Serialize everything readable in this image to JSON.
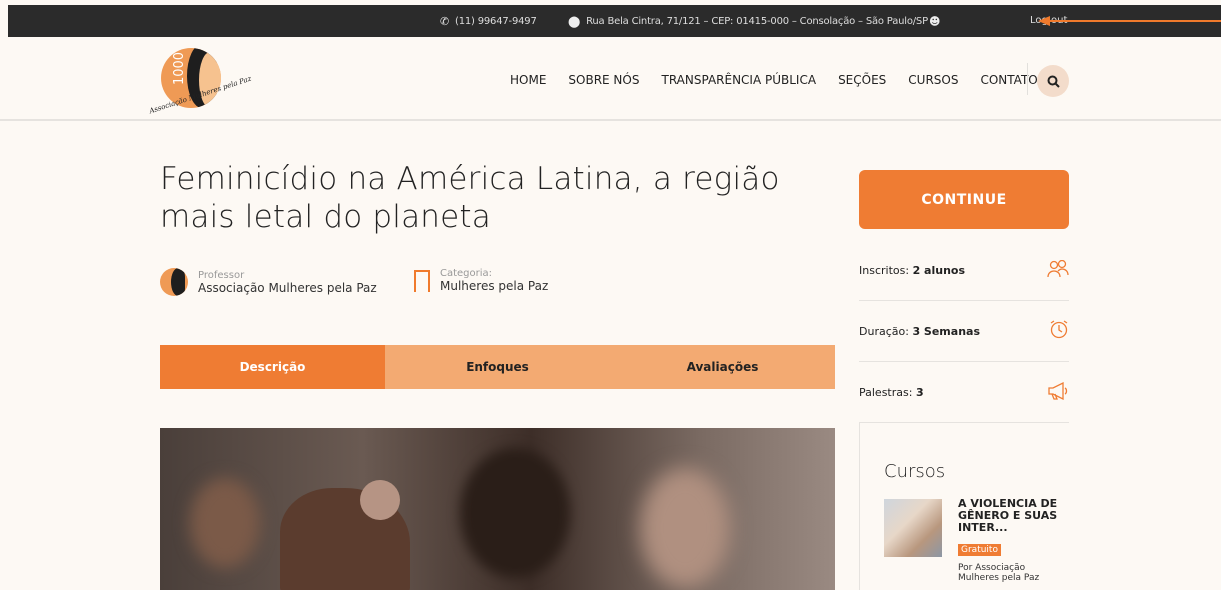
{
  "topbar": {
    "phone": "(11) 99647-9497",
    "address": "Rua Bela Cintra, 71/121 – CEP: 01415-000 – Consolação – São Paulo/SP",
    "logout": "Log out",
    "icons": [
      "phone-icon",
      "map-marker-icon",
      "user-icon"
    ]
  },
  "logo": {
    "number": "1000",
    "tagline": "Associação Mulheres pela Paz"
  },
  "nav": {
    "items": [
      "HOME",
      "SOBRE NÓS",
      "TRANSPARÊNCIA PÚBLICA",
      "SEÇÕES",
      "CURSOS",
      "CONTATO"
    ]
  },
  "course": {
    "title": "Feminicídio na América Latina, a região mais letal do planeta",
    "teacher_label": "Professor",
    "teacher": "Associação Mulheres pela Paz",
    "category_label": "Categoria:",
    "category": "Mulheres pela Paz"
  },
  "tabs": [
    "Descrição",
    "Enfoques",
    "Avaliações"
  ],
  "sidebar": {
    "continue": "CONTINUE",
    "enrolled_label": "Inscritos:",
    "enrolled_value": "2 alunos",
    "duration_label": "Duração:",
    "duration_value": "3 Semanas",
    "lectures_label": "Palestras:",
    "lectures_value": "3",
    "courses_heading": "Cursos",
    "course_item": {
      "title": "A VIOLENCIA DE GÊNERO E SUAS INTER...",
      "badge": "Gratuito",
      "by": "Por Associação Mulheres pela Paz"
    }
  },
  "colors": {
    "accent": "#ef7c33",
    "accent_light": "#f3aa72",
    "topbar_bg": "#2b2b2b",
    "page_bg": "#fdf9f4"
  }
}
